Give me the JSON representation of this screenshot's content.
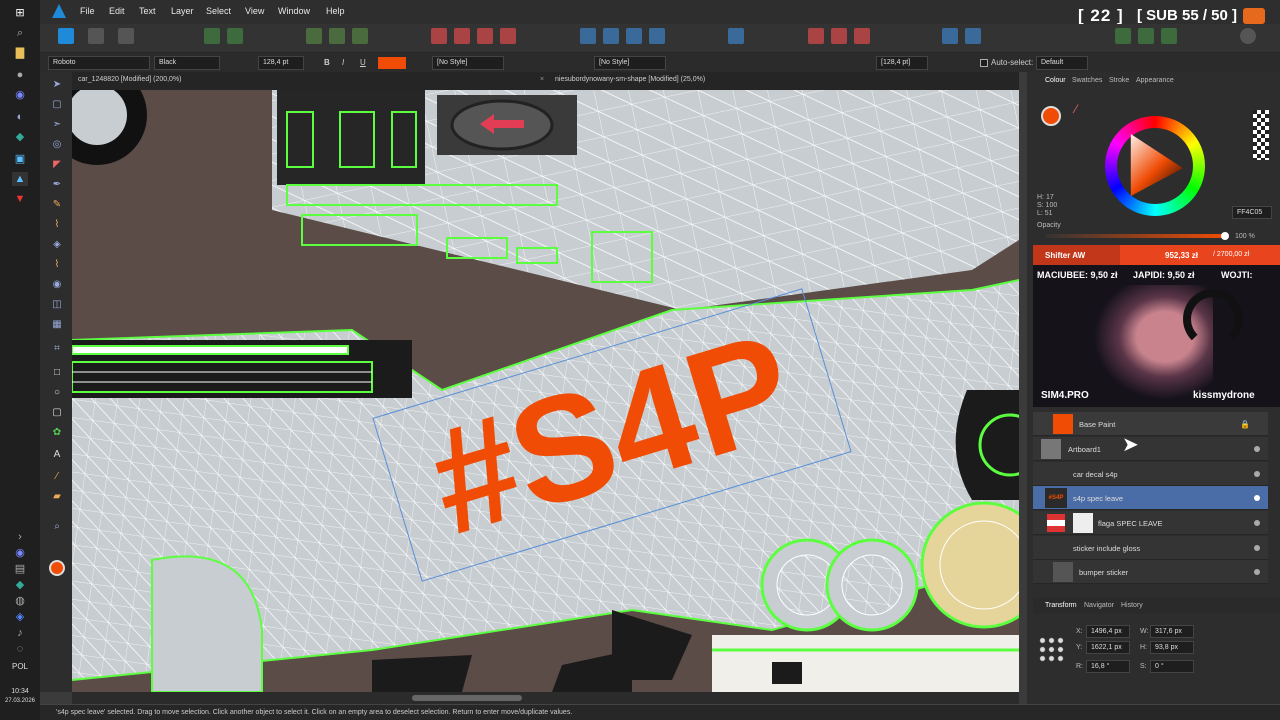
{
  "app": {
    "name": "Affinity Designer"
  },
  "menu": {
    "items": [
      "File",
      "Edit",
      "Text",
      "Layer",
      "Select",
      "View",
      "Window",
      "Help"
    ]
  },
  "stream_counters": {
    "count": "[ 22 ]",
    "subs": "[ SUB 55 / 50 ]"
  },
  "context_toolbar": {
    "font_family": "Roboto",
    "font_style": "Black",
    "font_size": "128,4 pt",
    "bold": "B",
    "italic": "I",
    "underline": "U",
    "char_style": "[No Style]",
    "para_style": "[No Style]",
    "size_field": "[128,4 pt]",
    "auto_select_label": "Auto-select:",
    "auto_select_value": "Default",
    "text_color": "#F04C05"
  },
  "doc_tabs": [
    {
      "label": "car_1248820 [Modified] (200,0%)"
    },
    {
      "label": "niesubordynowany-sm-shape [Modified] (25,0%)"
    }
  ],
  "canvas": {
    "decal_text": "#S4P",
    "decal_color": "#F04C05"
  },
  "taskbar": {
    "lang": "POL",
    "time": "10:34",
    "date": "27.03.2026"
  },
  "right_panel": {
    "tabs": [
      "Colour",
      "Swatches",
      "Stroke",
      "Appearance"
    ],
    "hsl": {
      "h": "H: 17",
      "s": "S: 100",
      "l": "L: 51"
    },
    "hex": "FF4C05",
    "opacity_label": "Opacity",
    "opacity_value": "100 %",
    "opacity_fraction": 1.0
  },
  "stream_overlay": {
    "shifter_label": "Shifter AW",
    "goal_amount": "952,33 zł",
    "goal_total": "/ 2700,00 zł",
    "goal_progress": 0.353,
    "ticker": [
      "MACIUBEE: 9,50 zł",
      "JAPIDI: 9,50 zł",
      "WOJTI:"
    ],
    "brand": "SIM4.PRO",
    "channel": "kissmydrone"
  },
  "layers": [
    {
      "name": "Base Paint"
    },
    {
      "name": "Artboard1"
    },
    {
      "name": "car decal s4p"
    },
    {
      "name": "s4p spec leave",
      "selected": true
    },
    {
      "name": "flaga SPEC LEAVE"
    },
    {
      "name": "sticker include gloss"
    },
    {
      "name": "bumper sticker"
    }
  ],
  "transform_tabs": [
    "Transform",
    "Navigator",
    "History"
  ],
  "transform": {
    "x_label": "X:",
    "x": "1496,4 px",
    "y_label": "Y:",
    "y": "1622,1 px",
    "w_label": "W:",
    "w": "317,6 px",
    "h_label": "H:",
    "h": "93,8 px",
    "r_label": "R:",
    "r": "16,8 °",
    "s_label": "S:",
    "s": "0 °"
  },
  "status": {
    "text": "'s4p spec leave' selected. Drag to move selection. Click another object to select it. Click on an empty area to deselect selection. Return to enter move/duplicate values."
  }
}
